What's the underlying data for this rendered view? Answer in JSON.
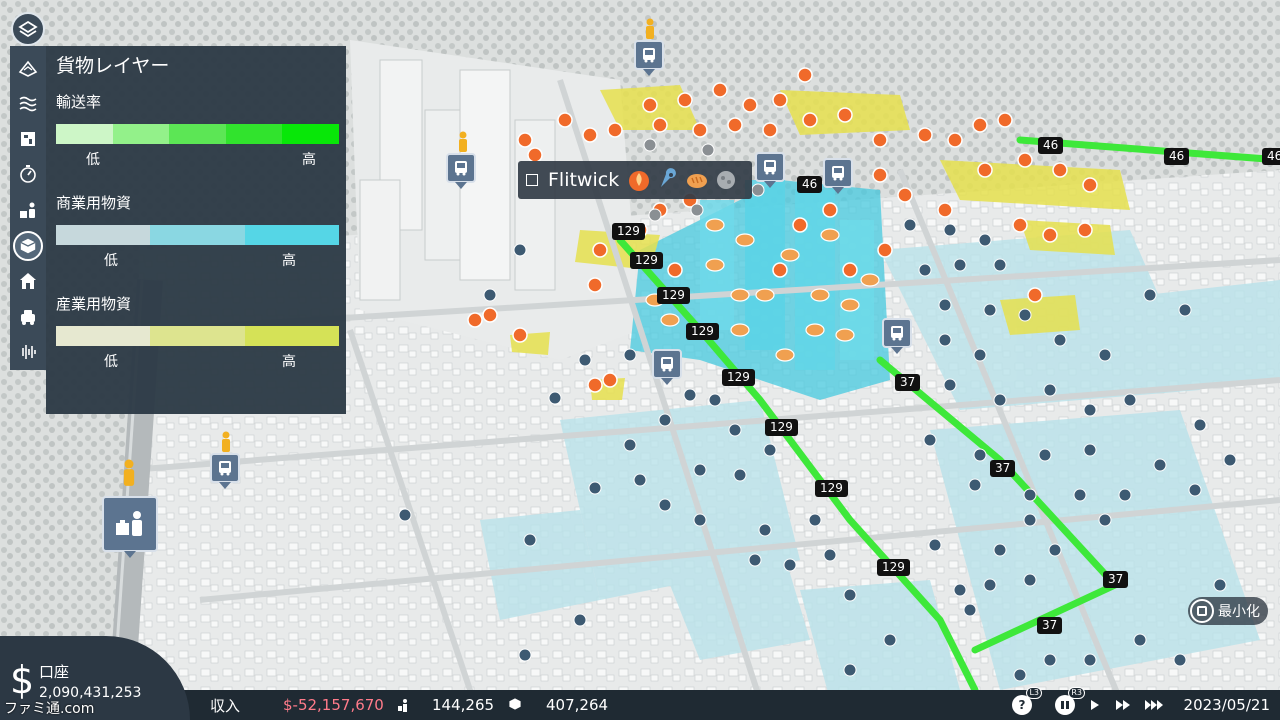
{
  "cargo_panel": {
    "title": "貨物レイヤー",
    "legends": [
      {
        "title": "輸送率",
        "low": "低",
        "high": "高",
        "colors": [
          "#cdf6c7",
          "#93f18a",
          "#5ce655",
          "#31e32d",
          "#08e708"
        ]
      },
      {
        "title": "商業用物資",
        "low": "低",
        "high": "高",
        "colors": [
          "#c6d8dc",
          "#8ad7e2",
          "#55d6e6"
        ]
      },
      {
        "title": "産業用物資",
        "low": "低",
        "high": "高",
        "colors": [
          "#e6e8d0",
          "#dde48f",
          "#d5e257"
        ]
      }
    ]
  },
  "toolbar": {
    "icons": [
      "layers-icon",
      "terrain-icon",
      "water-icon",
      "billboard-icon",
      "speed-icon",
      "population-icon",
      "cargo-icon",
      "services-icon",
      "traffic-icon",
      "noise-icon"
    ]
  },
  "tooltip": {
    "district_name": "Flitwick",
    "icons": [
      "fire-icon",
      "wrench-icon",
      "bread-icon",
      "ore-icon"
    ]
  },
  "map": {
    "road_labels": [
      "46",
      "46",
      "46",
      "46",
      "129",
      "129",
      "129",
      "129",
      "129",
      "129",
      "129",
      "129",
      "37",
      "37",
      "37",
      "37"
    ]
  },
  "minimize": {
    "label": "最小化"
  },
  "account": {
    "label": "口座",
    "value": "2,090,431,253",
    "currency_symbol": "$"
  },
  "bottom_bar": {
    "income_label": "収入",
    "income_value": "$-52,157,670",
    "population": "144,265",
    "cargo": "407,264",
    "date": "2023/05/21",
    "controls": {
      "l3": "L3",
      "r3": "R3",
      "help": "?"
    }
  },
  "watermark": "ファミ通.com",
  "colors": {
    "panel": "#2d3a46",
    "route_green": "#3ee83a",
    "commercial": "#4fd3e6",
    "industrial": "#e2df4a",
    "negative": "#ff7b8a"
  }
}
